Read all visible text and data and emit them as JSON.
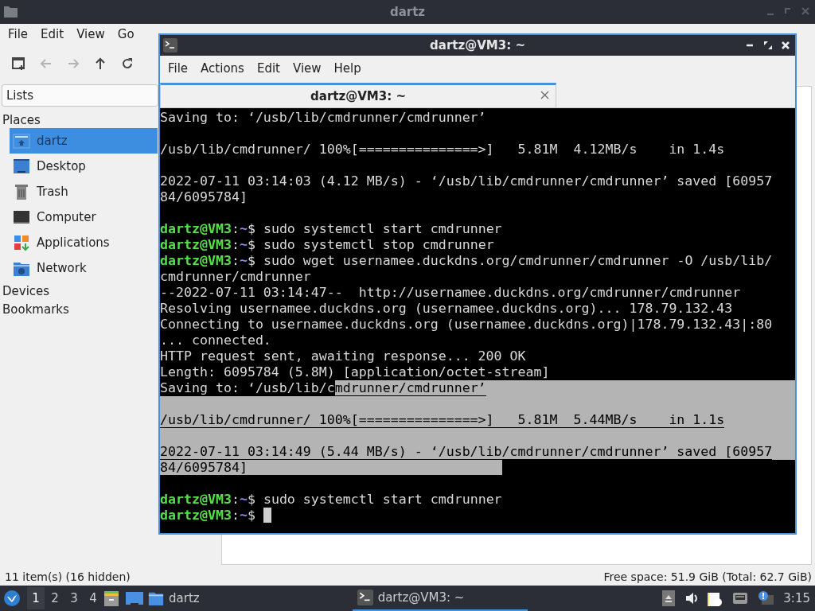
{
  "file_manager": {
    "title": "dartz",
    "menu": [
      "File",
      "Edit",
      "View",
      "Go"
    ],
    "toolbar": [
      {
        "kind": "new-tab",
        "disabled": false
      },
      {
        "kind": "back",
        "disabled": true
      },
      {
        "kind": "forward",
        "disabled": true
      },
      {
        "kind": "up",
        "disabled": false
      },
      {
        "kind": "reload",
        "disabled": false
      }
    ],
    "side_pane_mode": "Lists",
    "sections": [
      {
        "title": "Places",
        "items": [
          {
            "label": "dartz",
            "kind": "home",
            "selected": true
          },
          {
            "label": "Desktop",
            "kind": "desktop",
            "selected": false
          },
          {
            "label": "Trash",
            "kind": "trash",
            "selected": false
          },
          {
            "label": "Computer",
            "kind": "computer",
            "selected": false
          },
          {
            "label": "Applications",
            "kind": "applications",
            "selected": false
          },
          {
            "label": "Network",
            "kind": "network",
            "selected": false
          }
        ]
      },
      {
        "title": "Devices"
      },
      {
        "title": "Bookmarks"
      }
    ],
    "status_left": "11 item(s) (16 hidden)",
    "status_right": "Free space: 51.9 GiB (Total: 62.7 GiB)"
  },
  "terminal": {
    "title": "dartz@VM3: ~",
    "menu": [
      "File",
      "Actions",
      "Edit",
      "View",
      "Help"
    ],
    "tabs": [
      {
        "label": "dartz@VM3: ~",
        "selected": true
      }
    ],
    "lines": [
      {
        "kind": "text",
        "segments": [
          {
            "kind": "plain",
            "text": "Saving to: ‘/usb/lib/cmdrunner/cmdrunner’"
          }
        ]
      },
      {
        "kind": "blank"
      },
      {
        "kind": "text",
        "segments": [
          {
            "kind": "plain",
            "text": "/usb/lib/cmdrunner/ 100%[===============>]   5.81M  4.12MB/s    in 1.4s"
          }
        ]
      },
      {
        "kind": "blank"
      },
      {
        "kind": "text",
        "segments": [
          {
            "kind": "plain",
            "text": "2022-07-11 03:14:03 (4.12 MB/s) - ‘/usb/lib/cmdrunner/cmdrunner’ saved [60957"
          }
        ]
      },
      {
        "kind": "text",
        "segments": [
          {
            "kind": "plain",
            "text": "84/6095784]"
          }
        ]
      },
      {
        "kind": "blank"
      },
      {
        "kind": "text",
        "segments": [
          {
            "kind": "user",
            "text": "dartz@VM3"
          },
          {
            "kind": "plain",
            "text": ":"
          },
          {
            "kind": "dir",
            "text": "~"
          },
          {
            "kind": "plain",
            "text": "$ sudo systemctl start cmdrunner"
          }
        ]
      },
      {
        "kind": "text",
        "segments": [
          {
            "kind": "user",
            "text": "dartz@VM3"
          },
          {
            "kind": "plain",
            "text": ":"
          },
          {
            "kind": "dir",
            "text": "~"
          },
          {
            "kind": "plain",
            "text": "$ sudo systemctl stop cmdrunner"
          }
        ]
      },
      {
        "kind": "text",
        "segments": [
          {
            "kind": "user",
            "text": "dartz@VM3"
          },
          {
            "kind": "plain",
            "text": ":"
          },
          {
            "kind": "dir",
            "text": "~"
          },
          {
            "kind": "plain",
            "text": "$ sudo wget usernamee.duckdns.org/cmdrunner/cmdrunner -O /usb/lib/"
          }
        ]
      },
      {
        "kind": "text",
        "segments": [
          {
            "kind": "plain",
            "text": "cmdrunner/cmdrunner"
          }
        ]
      },
      {
        "kind": "text",
        "segments": [
          {
            "kind": "plain",
            "text": "--2022-07-11 03:14:47--  http://usernamee.duckdns.org/cmdrunner/cmdrunner"
          }
        ]
      },
      {
        "kind": "text",
        "segments": [
          {
            "kind": "plain",
            "text": "Resolving usernamee.duckdns.org (usernamee.duckdns.org)... 178.79.132.43"
          }
        ]
      },
      {
        "kind": "text",
        "segments": [
          {
            "kind": "plain",
            "text": "Connecting to usernamee.duckdns.org (usernamee.duckdns.org)|178.79.132.43|:80"
          }
        ]
      },
      {
        "kind": "text",
        "segments": [
          {
            "kind": "plain",
            "text": "... connected."
          }
        ]
      },
      {
        "kind": "text",
        "segments": [
          {
            "kind": "plain",
            "text": "HTTP request sent, awaiting response... 200 OK"
          }
        ]
      },
      {
        "kind": "text",
        "segments": [
          {
            "kind": "plain",
            "text": "Length: 6095784 (5.8M) [application/octet-stream]"
          }
        ]
      },
      {
        "kind": "text",
        "fill": true,
        "segments": [
          {
            "kind": "plain",
            "text": "Saving to: ‘/usb/lib/c"
          },
          {
            "kind": "selected",
            "text": "mdrunner/cmdrunner’"
          }
        ]
      },
      {
        "kind": "blank",
        "fill": true
      },
      {
        "kind": "text",
        "fill": true,
        "segments": [
          {
            "kind": "selected",
            "text": "/usb/lib/cmdrunner/ 100%[===============>]   5.81M  5.44MB/s    in 1.1s"
          }
        ]
      },
      {
        "kind": "blank",
        "fill": true
      },
      {
        "kind": "text",
        "fill": true,
        "segments": [
          {
            "kind": "selected",
            "text": "2022-07-11 03:14:49 (5.44 MB/s) - ‘/usb/lib/cmdrunner/cmdrunner’ saved [60957"
          }
        ]
      },
      {
        "kind": "text",
        "segments": [
          {
            "kind": "selected",
            "text": "84/6095784]                                "
          }
        ]
      },
      {
        "kind": "blank"
      },
      {
        "kind": "text",
        "segments": [
          {
            "kind": "user",
            "text": "dartz@VM3"
          },
          {
            "kind": "plain",
            "text": ":"
          },
          {
            "kind": "dir",
            "text": "~"
          },
          {
            "kind": "plain",
            "text": "$ sudo systemctl start cmdrunner"
          }
        ]
      },
      {
        "kind": "text",
        "cursor": true,
        "segments": [
          {
            "kind": "user",
            "text": "dartz@VM3"
          },
          {
            "kind": "plain",
            "text": ":"
          },
          {
            "kind": "dir",
            "text": "~"
          },
          {
            "kind": "plain",
            "text": "$ "
          }
        ]
      }
    ]
  },
  "taskbar": {
    "workspaces": [
      {
        "label": "1",
        "selected": true
      },
      {
        "label": "2",
        "selected": false
      },
      {
        "label": "3",
        "selected": false
      },
      {
        "label": "4",
        "selected": false
      }
    ],
    "tasks": [
      {
        "label": "dartz",
        "kind": "folder",
        "selected": false
      },
      {
        "label": "dartz@VM3: ~",
        "kind": "terminal",
        "selected": true
      }
    ],
    "clock": "3:15"
  }
}
